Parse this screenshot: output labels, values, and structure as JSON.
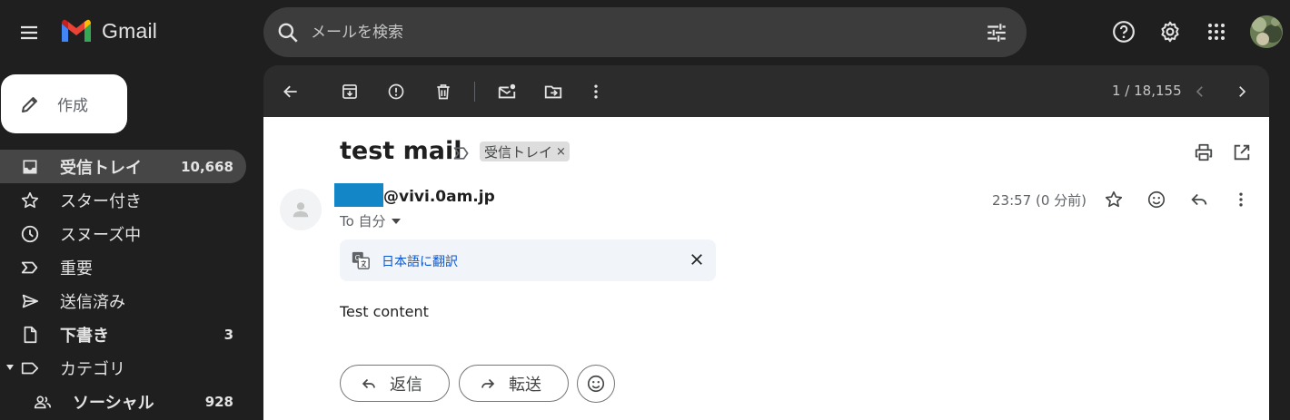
{
  "app": {
    "name": "Gmail"
  },
  "search": {
    "placeholder": "メールを検索"
  },
  "sidebar": {
    "compose_label": "作成",
    "items": [
      {
        "label": "受信トレイ",
        "count": "10,668",
        "icon": "inbox-icon",
        "active": true,
        "bold": true
      },
      {
        "label": "スター付き",
        "count": "",
        "icon": "star-icon"
      },
      {
        "label": "スヌーズ中",
        "count": "",
        "icon": "clock-icon"
      },
      {
        "label": "重要",
        "count": "",
        "icon": "important-icon"
      },
      {
        "label": "送信済み",
        "count": "",
        "icon": "send-icon"
      },
      {
        "label": "下書き",
        "count": "3",
        "icon": "draft-icon",
        "bold": true
      },
      {
        "label": "カテゴリ",
        "count": "",
        "icon": "label-icon"
      },
      {
        "label": "ソーシャル",
        "count": "928",
        "icon": "people-icon",
        "bold": true
      }
    ]
  },
  "toolbar": {
    "pager": "1 / 18,155"
  },
  "message": {
    "subject": "test mail",
    "label_chip": "受信トレイ",
    "label_chip_close": "×",
    "sender": "@vivi.0am.jp",
    "to": "To 自分",
    "timestamp": "23:57 (0 分前)",
    "translate_link": "日本語に翻訳",
    "body": "Test content"
  },
  "actions": {
    "reply": "返信",
    "forward": "転送"
  },
  "colors": {
    "accent": "#0b57d0",
    "redaction": "#1386c7",
    "background": "#1f1f1f",
    "active_nav": "#464646"
  }
}
